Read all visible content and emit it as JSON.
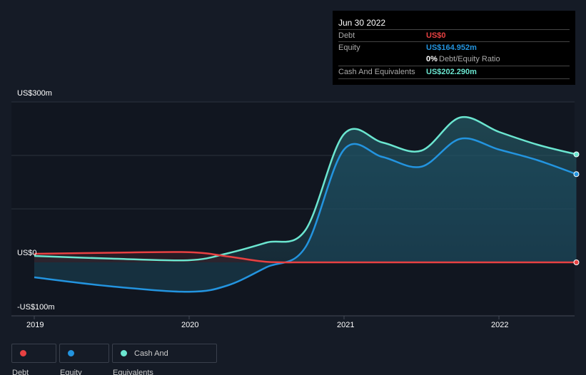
{
  "tooltip": {
    "date": "Jun 30 2022",
    "debt_label": "Debt",
    "debt_value": "US$0",
    "equity_label": "Equity",
    "equity_value": "US$164.952m",
    "ratio_value": "0%",
    "ratio_label": "Debt/Equity Ratio",
    "cash_label": "Cash And Equivalents",
    "cash_value": "US$202.290m"
  },
  "chart_data": {
    "type": "area",
    "y_tick_labels": [
      "US$300m",
      "US$0",
      "-US$100m"
    ],
    "ylim": [
      -100,
      300
    ],
    "xlim": [
      2018.92,
      2022.5
    ],
    "x_tick_labels": [
      "2019",
      "2020",
      "2021",
      "2022"
    ],
    "x_ticks": [
      2019,
      2020,
      2021,
      2022
    ],
    "legend": [
      "Debt",
      "Equity",
      "Cash And Equivalents"
    ],
    "legend_placement": "bottom-left",
    "colors": {
      "Debt": "#e84142",
      "Equity": "#2394df",
      "Cash And Equivalents": "#6be6d0"
    },
    "series": [
      {
        "name": "Cash And Equivalents",
        "x": [
          2019,
          2019.5,
          2020,
          2020.25,
          2020.5,
          2020.75,
          2021,
          2021.25,
          2021.5,
          2021.75,
          2022,
          2022.25,
          2022.5
        ],
        "values": [
          12,
          7,
          4,
          17,
          37,
          60,
          240,
          224,
          209,
          271,
          244,
          220,
          202
        ]
      },
      {
        "name": "Equity",
        "x": [
          2019,
          2019.5,
          2020,
          2020.25,
          2020.5,
          2020.75,
          2021,
          2021.25,
          2021.5,
          2021.75,
          2022,
          2022.25,
          2022.5
        ],
        "values": [
          -28,
          -45,
          -55,
          -43,
          -9,
          28,
          211,
          197,
          179,
          231,
          211,
          191,
          165
        ]
      },
      {
        "name": "Debt",
        "x": [
          2019,
          2019.5,
          2020,
          2020.25,
          2020.5,
          2020.75,
          2021,
          2021.5,
          2022,
          2022.5
        ],
        "values": [
          16,
          18,
          19,
          11,
          1,
          0,
          0,
          0,
          0,
          0
        ]
      }
    ]
  }
}
